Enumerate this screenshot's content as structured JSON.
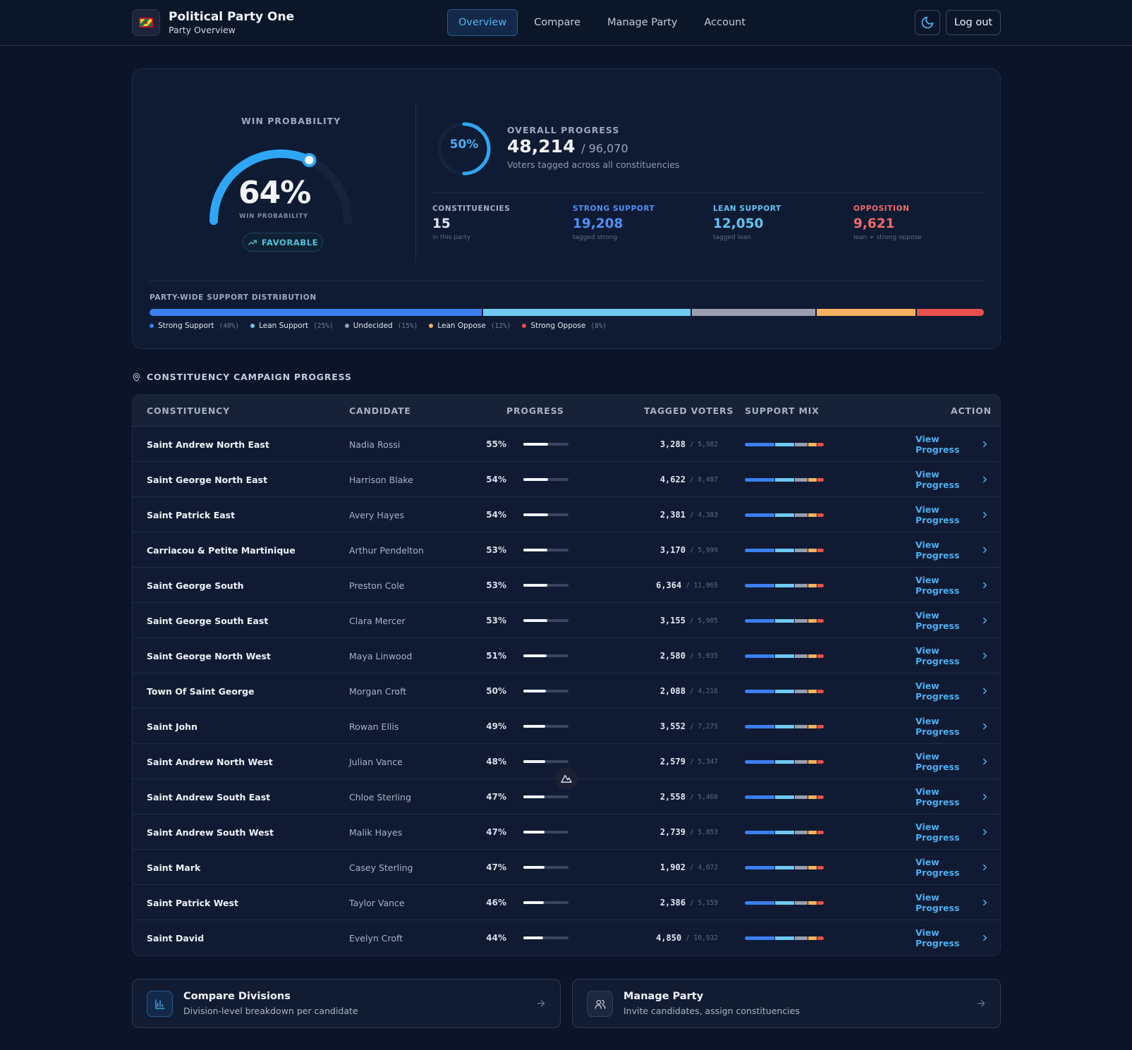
{
  "header": {
    "title": "Political Party One",
    "subtitle": "Party Overview",
    "nav": [
      "Overview",
      "Compare",
      "Manage Party",
      "Account"
    ],
    "active_nav": "Overview",
    "logout_label": "Log out",
    "theme_icon": "moon-icon"
  },
  "summary": {
    "win_label": "WIN PROBABILITY",
    "win_value": "64%",
    "win_fraction": 0.64,
    "win_sub": "WIN PROBABILITY",
    "win_badge": "FAVORABLE",
    "progress_ring_value": "50%",
    "progress_fraction": 0.5,
    "overall_label": "OVERALL PROGRESS",
    "overall_tagged": "48,214",
    "overall_total": "/ 96,070",
    "overall_desc": "Voters tagged across all constituencies",
    "stats": [
      {
        "label": "CONSTITUENCIES",
        "value": "15",
        "note": "in this party",
        "color": "#dfe4ee"
      },
      {
        "label": "STRONG SUPPORT",
        "value": "19,208",
        "note": "tagged strong",
        "color": "#4f8ff7"
      },
      {
        "label": "LEAN SUPPORT",
        "value": "12,050",
        "note": "tagged lean",
        "color": "#60c3f0"
      },
      {
        "label": "OPPOSITION",
        "value": "9,621",
        "note": "lean + strong oppose",
        "color": "#f06a6a"
      }
    ],
    "distribution_label": "PARTY-WIDE SUPPORT DISTRIBUTION",
    "distribution": [
      {
        "label": "Strong Support",
        "pct": "(40%)",
        "value": 40,
        "color": "#3b7ff0"
      },
      {
        "label": "Lean Support",
        "pct": "(25%)",
        "value": 25,
        "color": "#6fcaf2"
      },
      {
        "label": "Undecided",
        "pct": "(15%)",
        "value": 15,
        "color": "#98a0ae"
      },
      {
        "label": "Lean Oppose",
        "pct": "(12%)",
        "value": 12,
        "color": "#f6b25e"
      },
      {
        "label": "Strong Oppose",
        "pct": "(8%)",
        "value": 8,
        "color": "#e8504e"
      }
    ]
  },
  "section": {
    "title": "CONSTITUENCY CAMPAIGN PROGRESS"
  },
  "table": {
    "headers": [
      "CONSTITUENCY",
      "CANDIDATE",
      "PROGRESS",
      "TAGGED VOTERS",
      "SUPPORT MIX",
      "ACTION"
    ],
    "action_label": "View Progress",
    "rows": [
      {
        "constituency": "Saint Andrew North East",
        "candidate": "Nadia Rossi",
        "progress": "55%",
        "pct": 55,
        "tagged": "3,288",
        "total": "/ 5,982"
      },
      {
        "constituency": "Saint George North East",
        "candidate": "Harrison Blake",
        "progress": "54%",
        "pct": 54,
        "tagged": "4,622",
        "total": "/ 8,487"
      },
      {
        "constituency": "Saint Patrick East",
        "candidate": "Avery Hayes",
        "progress": "54%",
        "pct": 54,
        "tagged": "2,381",
        "total": "/ 4,383"
      },
      {
        "constituency": "Carriacou & Petite Martinique",
        "candidate": "Arthur Pendelton",
        "progress": "53%",
        "pct": 53,
        "tagged": "3,170",
        "total": "/ 5,999"
      },
      {
        "constituency": "Saint George South",
        "candidate": "Preston Cole",
        "progress": "53%",
        "pct": 53,
        "tagged": "6,364",
        "total": "/ 11,965"
      },
      {
        "constituency": "Saint George South East",
        "candidate": "Clara Mercer",
        "progress": "53%",
        "pct": 53,
        "tagged": "3,155",
        "total": "/ 5,905"
      },
      {
        "constituency": "Saint George North West",
        "candidate": "Maya Linwood",
        "progress": "51%",
        "pct": 51,
        "tagged": "2,580",
        "total": "/ 5,035"
      },
      {
        "constituency": "Town Of Saint George",
        "candidate": "Morgan Croft",
        "progress": "50%",
        "pct": 50,
        "tagged": "2,088",
        "total": "/ 4,216"
      },
      {
        "constituency": "Saint John",
        "candidate": "Rowan Ellis",
        "progress": "49%",
        "pct": 49,
        "tagged": "3,552",
        "total": "/ 7,275"
      },
      {
        "constituency": "Saint Andrew North West",
        "candidate": "Julian Vance",
        "progress": "48%",
        "pct": 48,
        "tagged": "2,579",
        "total": "/ 5,347"
      },
      {
        "constituency": "Saint Andrew South East",
        "candidate": "Chloe Sterling",
        "progress": "47%",
        "pct": 47,
        "tagged": "2,558",
        "total": "/ 5,460"
      },
      {
        "constituency": "Saint Andrew South West",
        "candidate": "Malik Hayes",
        "progress": "47%",
        "pct": 47,
        "tagged": "2,739",
        "total": "/ 5,853"
      },
      {
        "constituency": "Saint Mark",
        "candidate": "Casey Sterling",
        "progress": "47%",
        "pct": 47,
        "tagged": "1,902",
        "total": "/ 4,072"
      },
      {
        "constituency": "Saint Patrick West",
        "candidate": "Taylor Vance",
        "progress": "46%",
        "pct": 46,
        "tagged": "2,386",
        "total": "/ 5,159"
      },
      {
        "constituency": "Saint David",
        "candidate": "Evelyn Croft",
        "progress": "44%",
        "pct": 44,
        "tagged": "4,850",
        "total": "/ 10,932"
      }
    ]
  },
  "cards": [
    {
      "title": "Compare Divisions",
      "subtitle": "Division-level breakdown per candidate",
      "icon": "bar-chart-icon"
    },
    {
      "title": "Manage Party",
      "subtitle": "Invite candidates, assign constituencies",
      "icon": "users-icon"
    }
  ]
}
